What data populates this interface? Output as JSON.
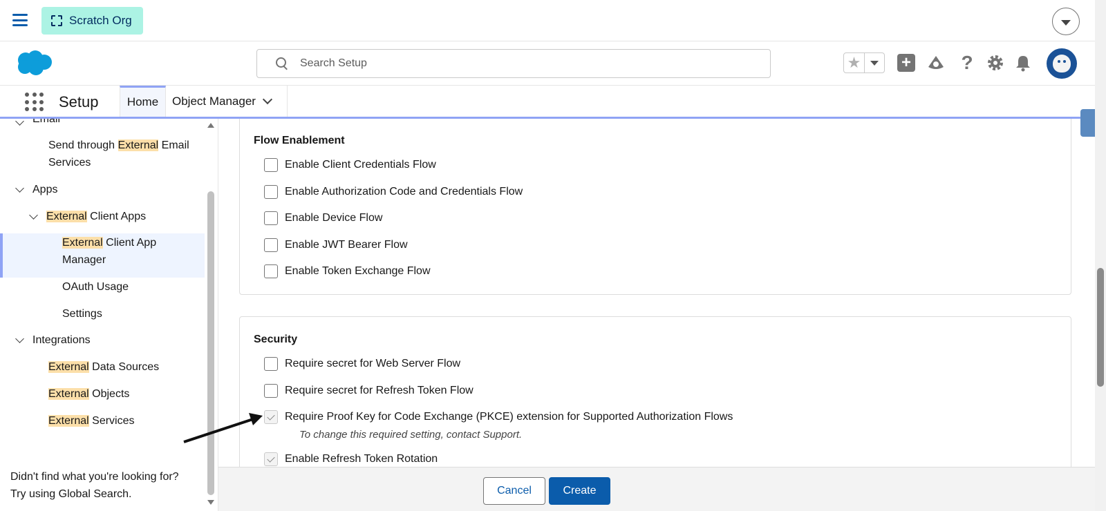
{
  "topbar": {
    "org_name": "Scratch Org"
  },
  "search": {
    "placeholder": "Search Setup"
  },
  "nav": {
    "app_name": "Setup",
    "tabs": [
      "Home",
      "Object Manager"
    ]
  },
  "sidebar": {
    "email_label": "Email",
    "send_external": {
      "highlight": "External",
      "before": "Send through ",
      "after": " Email",
      "line2": "Services"
    },
    "apps_label": "Apps",
    "ext_client_apps": {
      "highlight": "External",
      "after": " Client Apps"
    },
    "ext_client_app_manager": {
      "highlight": "External",
      "after": " Client App",
      "line2": "Manager"
    },
    "oauth_usage": "OAuth Usage",
    "settings": "Settings",
    "integrations_label": "Integrations",
    "ext_data_sources": {
      "highlight": "External",
      "after": " Data Sources"
    },
    "ext_objects": {
      "highlight": "External",
      "after": " Objects"
    },
    "ext_services": {
      "highlight": "External",
      "after": " Services"
    },
    "footer_line1": "Didn't find what you're looking for?",
    "footer_line2": "Try using Global Search."
  },
  "flow_card": {
    "title": "Flow Enablement",
    "options": [
      "Enable Client Credentials Flow",
      "Enable Authorization Code and Credentials Flow",
      "Enable Device Flow",
      "Enable JWT Bearer Flow",
      "Enable Token Exchange Flow"
    ]
  },
  "security_card": {
    "title": "Security",
    "options": [
      "Require secret for Web Server Flow",
      "Require secret for Refresh Token Flow",
      "Require Proof Key for Code Exchange (PKCE) extension for Supported Authorization Flows",
      "Enable Refresh Token Rotation"
    ],
    "pkce_help": "To change this required setting, contact Support."
  },
  "footer": {
    "cancel": "Cancel",
    "create": "Create"
  },
  "colors": {
    "brand": "#0b5cab",
    "org_badge": "#acf3e4",
    "highlight": "#fcdfa9",
    "active_tab": "#8fa3f5"
  }
}
